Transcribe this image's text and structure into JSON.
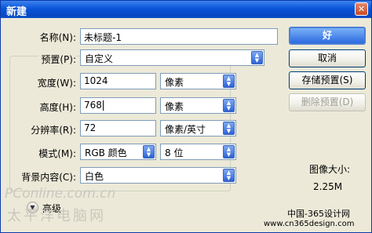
{
  "window": {
    "title": "新建",
    "close_glyph": "✕"
  },
  "form": {
    "name": {
      "label": "名称(N):",
      "value": "未标题-1"
    },
    "preset": {
      "label": "预置(P):",
      "value": "自定义"
    },
    "width": {
      "label": "宽度(W):",
      "value": "1024",
      "unit": "像素"
    },
    "height": {
      "label": "高度(H):",
      "value": "768",
      "unit": "像素"
    },
    "resolution": {
      "label": "分辨率(R):",
      "value": "72",
      "unit": "像素/英寸"
    },
    "mode": {
      "label": "模式(M):",
      "value": "RGB 颜色",
      "depth": "8 位"
    },
    "background": {
      "label": "背景内容(C):",
      "value": "白色"
    },
    "advanced": {
      "label": "高级"
    }
  },
  "buttons": {
    "ok": "好",
    "cancel": "取消",
    "save_preset": "存储预置(S)",
    "delete_preset": "删除预置(D)"
  },
  "image_size": {
    "label": "图像大小:",
    "value": "2.25M"
  },
  "watermarks": {
    "pconline": "PConline.com.cn",
    "pconline_cn": "太平洋电脑网",
    "cn365": "中国-365设计网",
    "cn365_url": "www.cn365design.com"
  }
}
